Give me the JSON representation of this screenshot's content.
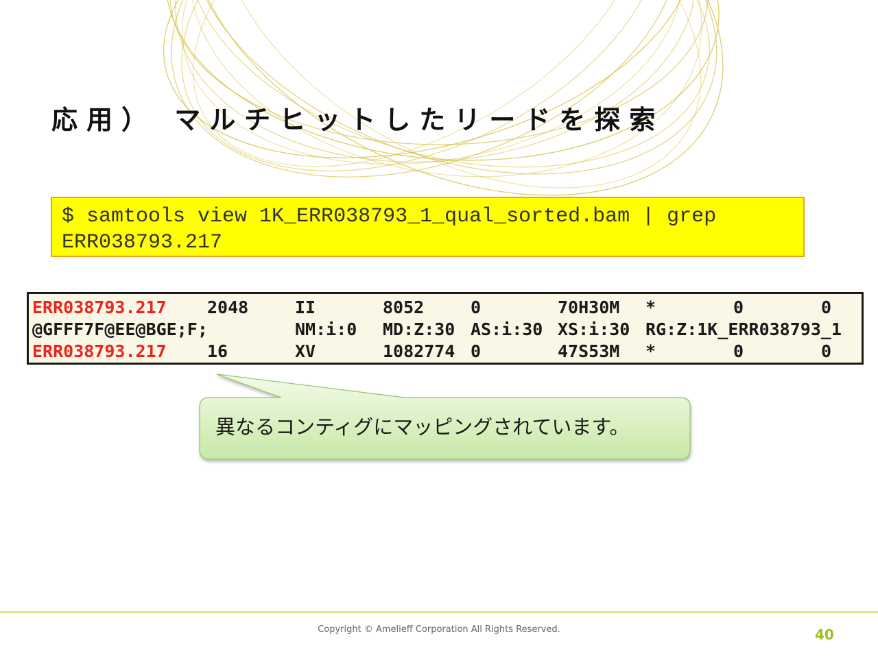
{
  "slide": {
    "title": "応用） マルチヒットしたリードを探索",
    "command_lines": [
      "$ samtools view 1K_ERR038793_1_qual_sorted.bam | grep",
      "ERR038793.217"
    ],
    "output_rows": [
      {
        "cells": [
          "ERR038793.217",
          "2048",
          "II",
          "8052",
          "0",
          "70H30M",
          "*",
          "0",
          "0"
        ],
        "highlight_first": true
      },
      {
        "cells": [
          "@GFFF7F@EE@BGE;F;",
          "NM:i:0",
          "MD:Z:30",
          "AS:i:30",
          "XS:i:30",
          "RG:Z:1K_ERR038793_1"
        ],
        "highlight_first": false
      },
      {
        "cells": [
          "ERR038793.217",
          "16",
          "XV",
          "1082774",
          "0",
          "47S53M",
          "*",
          "0",
          "0"
        ],
        "highlight_first": true
      }
    ],
    "callout": "異なるコンティグにマッピングされています。",
    "copyright": "Copyright © Amelieff Corporation All Rights Reserved.",
    "page_number": "40"
  },
  "colors": {
    "title": "#111111",
    "command_bg": "#ffff00",
    "command_border": "#f1a01e",
    "read_id_red": "#e8261f",
    "output_bg": "#fbf7e6",
    "callout_fill": "#dff3c4",
    "callout_border": "#8fc56a",
    "accent_green": "#9cbf1a",
    "deco_rings": "#d6c24a"
  }
}
